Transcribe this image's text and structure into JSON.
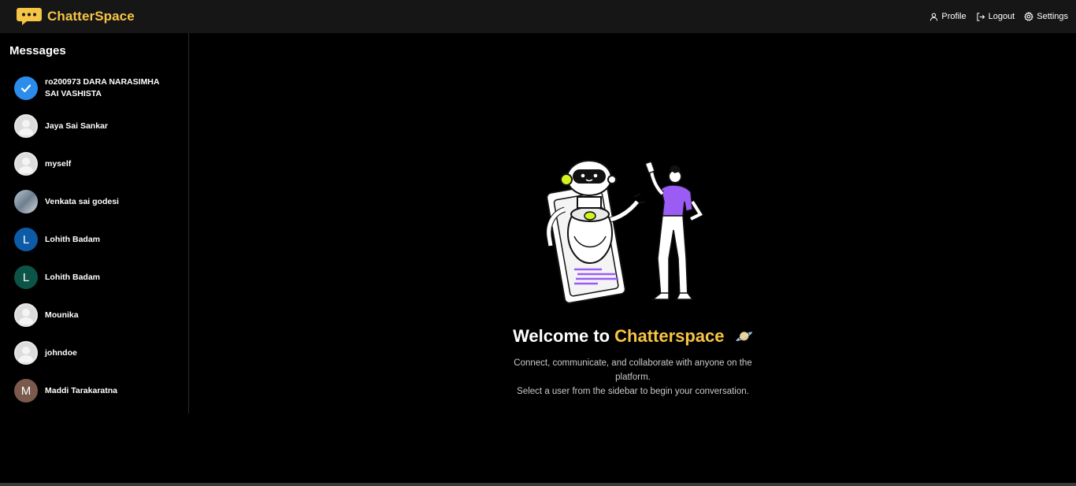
{
  "header": {
    "brand": "ChatterSpace",
    "nav": {
      "profile": "Profile",
      "logout": "Logout",
      "settings": "Settings"
    }
  },
  "sidebar": {
    "title": "Messages",
    "users": [
      {
        "name": "ro200973 DARA NARASIMHA SAI VASHISTA",
        "avatar": "check",
        "initial": ""
      },
      {
        "name": "Jaya Sai Sankar",
        "avatar": "default",
        "initial": ""
      },
      {
        "name": "myself",
        "avatar": "default",
        "initial": ""
      },
      {
        "name": "Venkata sai godesi",
        "avatar": "photo",
        "initial": ""
      },
      {
        "name": "Lohith Badam",
        "avatar": "letter",
        "initial": "L",
        "color": "#0d5aa7"
      },
      {
        "name": "Lohith Badam",
        "avatar": "letter",
        "initial": "L",
        "color": "#0c5448"
      },
      {
        "name": "Mounika",
        "avatar": "default",
        "initial": ""
      },
      {
        "name": "johndoe",
        "avatar": "default",
        "initial": ""
      },
      {
        "name": "Maddi Tarakaratna",
        "avatar": "letter",
        "initial": "M",
        "color": "#7a5a4d"
      }
    ]
  },
  "main": {
    "welcome_prefix": "Welcome to",
    "welcome_brand": "Chatterspace",
    "planet_icon": "🪐",
    "line1": "Connect, communicate, and collaborate with anyone on the platform.",
    "line2": "Select a user from the sidebar to begin your conversation."
  },
  "colors": {
    "accent": "#f7c545",
    "topbar": "#161616",
    "background": "#000000",
    "check_blue": "#2b8ceb",
    "illustration_purple": "#9b5cf6"
  }
}
